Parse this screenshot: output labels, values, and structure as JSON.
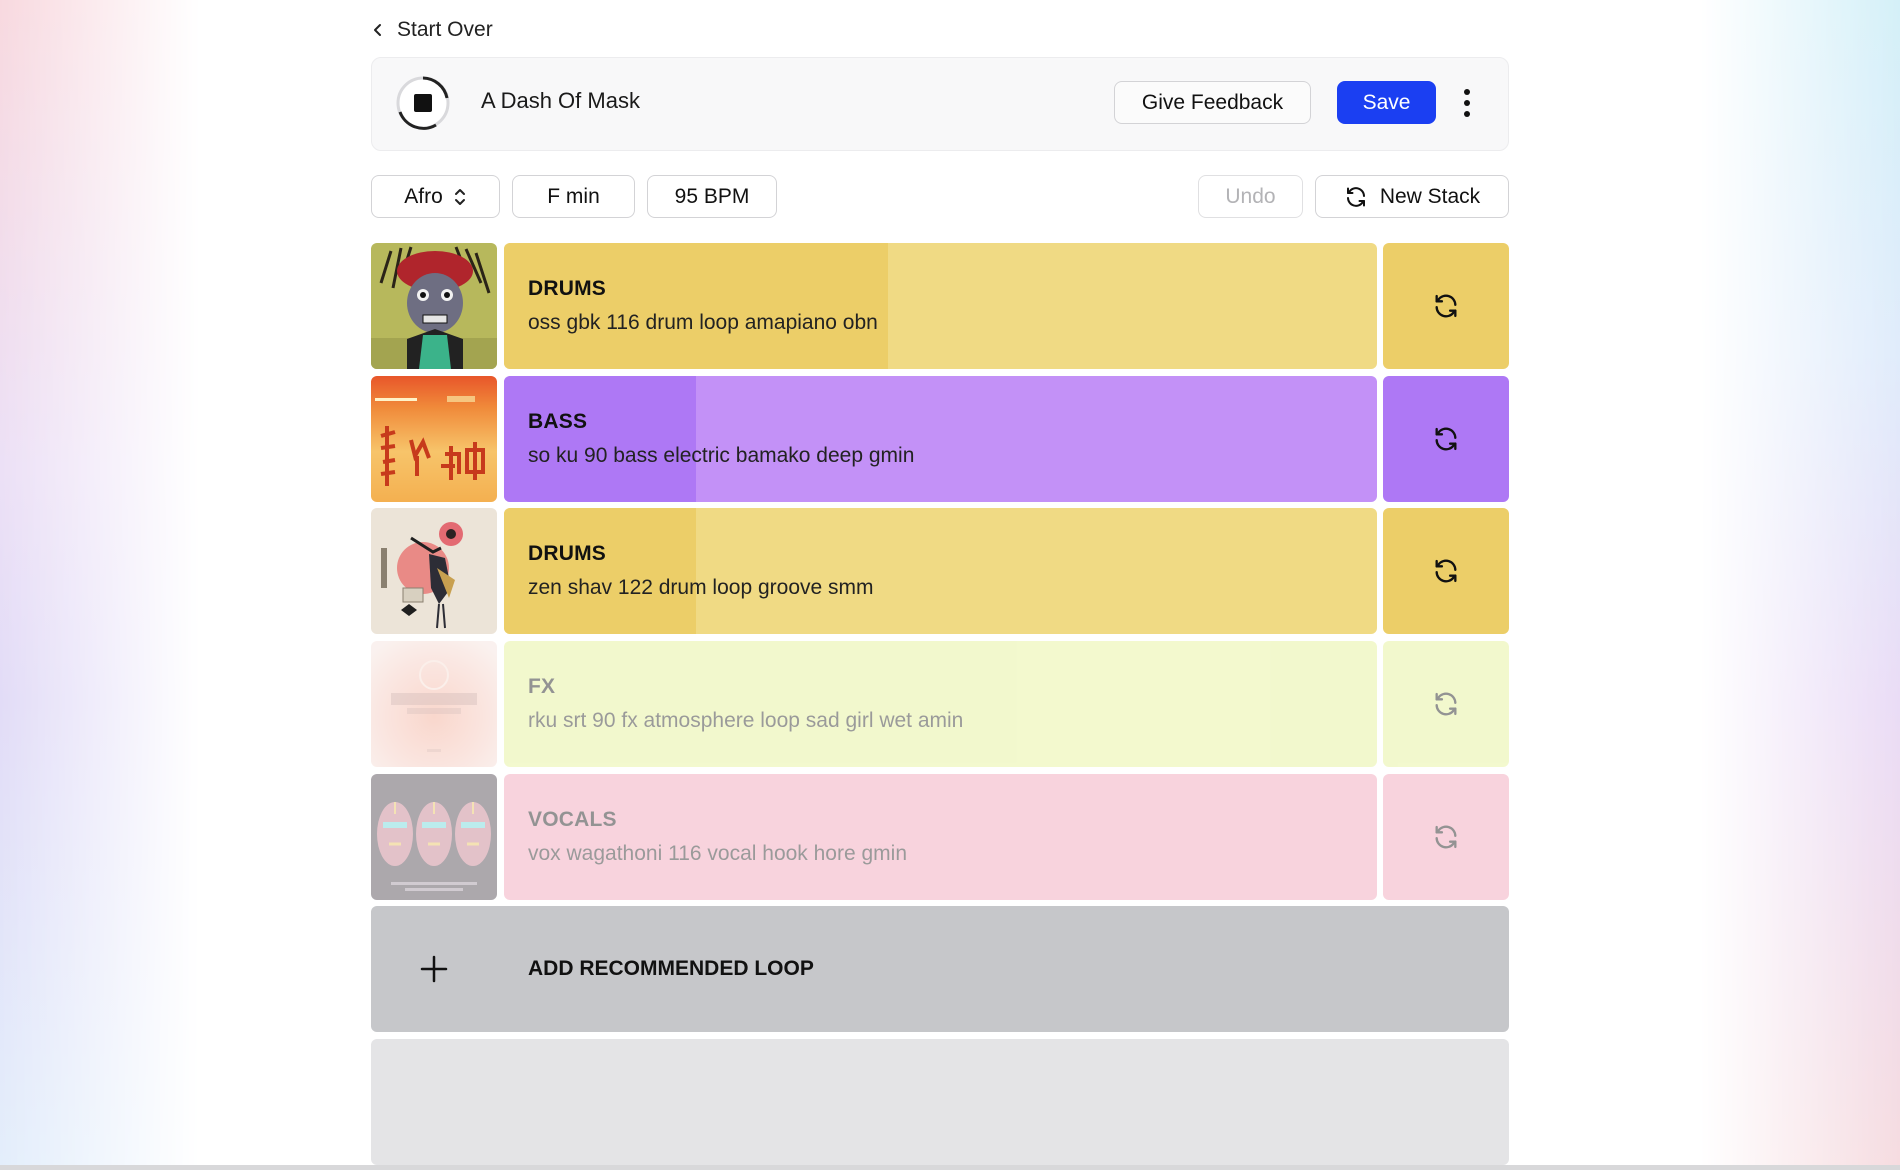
{
  "nav": {
    "back_label": "Start Over"
  },
  "header": {
    "title": "A Dash Of Mask",
    "feedback_label": "Give Feedback",
    "save_label": "Save",
    "accent": "#1b3ff2"
  },
  "controls": {
    "genre": "Afro",
    "key": "F min",
    "bpm": "95 BPM",
    "undo_label": "Undo",
    "new_stack_label": "New Stack"
  },
  "loops": [
    {
      "category": "DRUMS",
      "name": "oss gbk 116 drum loop amapiano obn",
      "color": "#f0da84",
      "progress_color": "#ecce68",
      "progress": 0.44,
      "active": true,
      "art": "dreadlock-figure"
    },
    {
      "category": "BASS",
      "name": "so ku 90 bass electric bamako deep gmin",
      "color": "#c391f7",
      "progress_color": "#ae78f5",
      "progress": 0.22,
      "active": true,
      "art": "orange-glyphs"
    },
    {
      "category": "DRUMS",
      "name": "zen shav 122 drum loop groove smm",
      "color": "#f0da84",
      "progress_color": "#ecce68",
      "progress": 0.22,
      "active": true,
      "art": "bird-collage"
    },
    {
      "category": "FX",
      "name": "rku srt 90 fx atmosphere loop sad girl wet amin",
      "color": "#e4f192",
      "progress_color": "#e4f192",
      "progress": 0,
      "active": false,
      "art": "soulmate-cover"
    },
    {
      "category": "VOCALS",
      "name": "vox wagathoni 116 vocal hook hore gmin",
      "color": "#f09eb4",
      "progress_color": "#f09eb4",
      "progress": 0,
      "active": false,
      "art": "three-masks"
    }
  ],
  "add_loop_label": "ADD RECOMMENDED LOOP"
}
